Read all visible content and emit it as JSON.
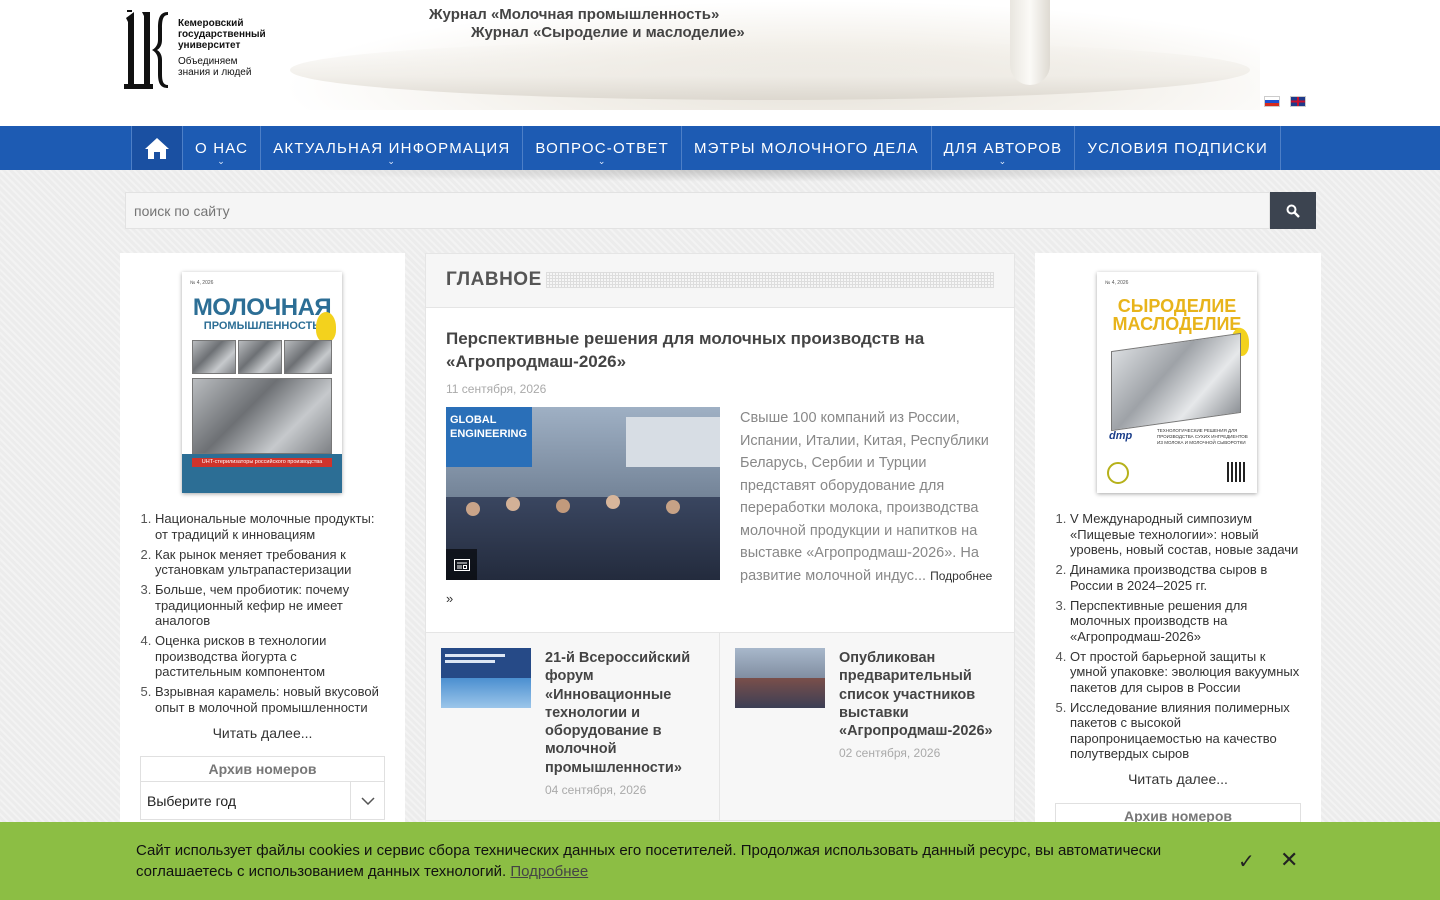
{
  "header": {
    "logo": {
      "name_lines": [
        "Кемеровский",
        "государственный",
        "университет"
      ],
      "slogan_lines": [
        "Объединяем",
        "знания и людей"
      ]
    },
    "journal1": "Журнал «Молочная промышленность»",
    "journal2": "Журнал «Сыроделие и маслоделие»",
    "flags": [
      "ru-flag-icon",
      "en-flag-icon"
    ]
  },
  "nav": {
    "home_icon": "home-icon",
    "items": [
      {
        "label": "О НАС",
        "dropdown": true
      },
      {
        "label": "АКТУАЛЬНАЯ ИНФОРМАЦИЯ",
        "dropdown": true
      },
      {
        "label": "ВОПРОС-ОТВЕТ",
        "dropdown": true
      },
      {
        "label": "МЭТРЫ МОЛОЧНОГО ДЕЛА",
        "dropdown": false
      },
      {
        "label": "ДЛЯ АВТОРОВ",
        "dropdown": true
      },
      {
        "label": "УСЛОВИЯ ПОДПИСКИ",
        "dropdown": false
      }
    ],
    "color": "#1d5bb3"
  },
  "search": {
    "placeholder": "поиск по сайту",
    "button_icon": "search-icon"
  },
  "left_sidebar": {
    "cover": {
      "top_line": "№ 4, 2026",
      "title_line1": "МОЛОЧНАЯ",
      "title_line2": "ПРОМЫШЛЕННОСТЬ",
      "band_text": "UHT-стерилизаторы российского производства"
    },
    "top_articles": [
      "Национальные молочные продукты: от традиций к инновациям",
      "Как рынок меняет требования к установкам ультрапастеризации",
      "Больше, чем пробиотик: почему традиционный кефир не имеет аналогов",
      "Оценка рисков в технологии производства йогурта с растительным компонентом",
      "Взрывная карамель: новый вкусовой опыт в молочной промышленности"
    ],
    "read_more": "Читать далее...",
    "archive": {
      "title": "Архив номеров",
      "select_value": "Выберите год"
    }
  },
  "right_sidebar": {
    "cover": {
      "top_line": "№ 4, 2026",
      "title_line1": "СЫРОДЕЛИЕ",
      "title_line2": "МАСЛОДЕЛИЕ",
      "brand": "dmp",
      "caption": "ТЕХНОЛОГИЧЕСКИЕ РЕШЕНИЯ ДЛЯ ПРОИЗВОДСТВА СУХИХ ИНГРЕДИЕНТОВ ИЗ МОЛОКА И МОЛОЧНОЙ СЫВОРОТКИ"
    },
    "top_articles": [
      "V Международный симпозиум «Пищевые технологии»: новый уровень, новый состав, новые задачи",
      "Динамика производства сыров в России в 2024–2025 гг.",
      "Перспективные решения для молочных производств на «Агропродмаш-2026»",
      "От простой барьерной защиты к умной упаковке: эволюция вакуумных пакетов для сыров в России",
      "Исследование влияния полимерных пакетов с высокой паропроницаемостью на качество полутвердых сыров"
    ],
    "read_more": "Читать далее...",
    "archive": {
      "title": "Архив номеров"
    }
  },
  "main": {
    "section_title": "ГЛАВНОЕ",
    "lead": {
      "title": "Перспективные решения для молочных производств на «Агропродмаш-2026»",
      "date": "11 сентября, 2026",
      "image_label": "GLOBAL ENGINEERING",
      "text": "Свыше 100 компаний из России, Испании, Италии, Китая, Республики Беларусь, Сербии и Турции представят оборудование для переработки молока, производства молочной продукции и напитков на выставке «Агропродмаш-2026». На развитие молочной индус...",
      "more": "Подробнее",
      "raquo": "»"
    },
    "cards": [
      {
        "title": "21-й Всероссийский форум «Инновационные технологии и оборудование в молочной промышленности»",
        "date": "04 сентября, 2026"
      },
      {
        "title": "Опубликован предварительный список участников выставки «Агропродмаш-2026»",
        "date": "02 сентября, 2026"
      }
    ]
  },
  "cookie": {
    "text": "Сайт использует файлы cookies и сервис сбора технических данных его посетителей. Продолжая использовать данный ресурс, вы автоматически соглашаетесь с использованием данных технологий.",
    "link": "Подробнее",
    "accept_icon": "check-icon",
    "close_icon": "close-icon",
    "color": "#8cbe44"
  }
}
